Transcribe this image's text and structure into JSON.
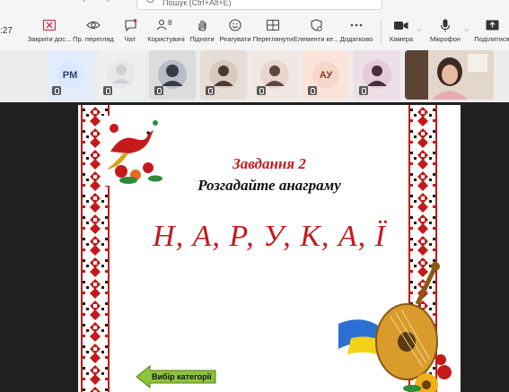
{
  "clock": ":27",
  "search": {
    "placeholder": "Пошук (Ctrl+Alt+E)"
  },
  "toolbar": [
    {
      "id": "close-panel",
      "label": "Закрити дос...",
      "icon": "close-panel-icon"
    },
    {
      "id": "view",
      "label": "Пр. перегляд",
      "icon": "eye-icon"
    },
    {
      "id": "chat",
      "label": "Чат",
      "icon": "chat-icon"
    },
    {
      "id": "people",
      "label": "Користувачі",
      "icon": "people-icon",
      "badge": "8"
    },
    {
      "id": "raise",
      "label": "Підняти",
      "icon": "hand-icon"
    },
    {
      "id": "react",
      "label": "Реагувати",
      "icon": "smile-icon"
    },
    {
      "id": "layout",
      "label": "Переглянути",
      "icon": "grid-icon"
    },
    {
      "id": "apps",
      "label": "Елементи ке...",
      "icon": "shield-icon"
    },
    {
      "id": "more",
      "label": "Додатково",
      "icon": "more-icon"
    },
    {
      "id": "camera",
      "label": "Камера",
      "icon": "camera-icon"
    },
    {
      "id": "mic",
      "label": "Мікрофон",
      "icon": "mic-icon"
    },
    {
      "id": "share",
      "label": "Поділитися",
      "icon": "share-icon"
    }
  ],
  "participants": [
    {
      "kind": "initials",
      "initials": "PM",
      "bg": "#dbe7ff",
      "fg": "#2c3e73"
    },
    {
      "kind": "photo",
      "bg": "#e9ecec",
      "fg": "#c9c9c9"
    },
    {
      "kind": "photo",
      "bg": "#dcdcdc",
      "fg": "#3a3a45"
    },
    {
      "kind": "photo",
      "bg": "#e4dcd6",
      "fg": "#4a3a32"
    },
    {
      "kind": "photo",
      "bg": "#f0e7e3",
      "fg": "#5a4a42"
    },
    {
      "kind": "initials",
      "initials": "АУ",
      "bg": "#f7d7c9",
      "fg": "#8a3a1f"
    },
    {
      "kind": "photo",
      "bg": "#ebdfe6",
      "fg": "#4b2c3e"
    }
  ],
  "slide": {
    "task": "Завдання 2",
    "instruction": "Розгадайте анаграму",
    "anagram": "Н, А, Р, У, К, А, Ї",
    "category_button": "Вибір категорії",
    "colors": {
      "red": "#c41a1a",
      "embroidery": "#c41a1a",
      "button": "#8fc33c"
    }
  }
}
